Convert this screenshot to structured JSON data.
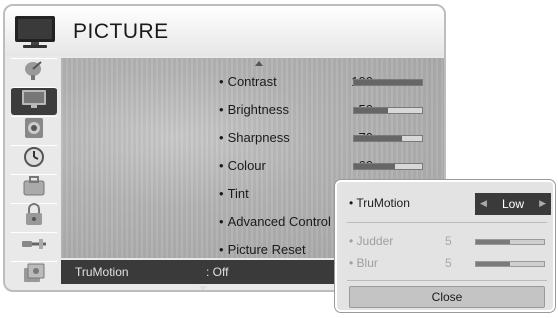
{
  "header": {
    "title": "PICTURE",
    "icon": "tv-icon"
  },
  "sidebar": {
    "items": [
      {
        "icon": "satellite-dish-icon"
      },
      {
        "icon": "tv-picture-icon",
        "active": true
      },
      {
        "icon": "speaker-audio-icon"
      },
      {
        "icon": "clock-icon"
      },
      {
        "icon": "briefcase-option-icon"
      },
      {
        "icon": "lock-icon"
      },
      {
        "icon": "input-cable-icon"
      },
      {
        "icon": "media-usb-icon"
      }
    ]
  },
  "menu": {
    "items": [
      {
        "label": "Contrast",
        "value": "100",
        "level": 1.0
      },
      {
        "label": "Brightness",
        "value": "50",
        "level": 0.5
      },
      {
        "label": "Sharpness",
        "value": "70",
        "level": 0.7
      },
      {
        "label": "Colour",
        "value": "60",
        "level": 0.6
      },
      {
        "label": "Tint"
      },
      {
        "label": "Advanced Control"
      },
      {
        "label": "Picture Reset"
      }
    ]
  },
  "status": {
    "label": "TruMotion",
    "value": ": Off"
  },
  "popup": {
    "trumotion_label": "TruMotion",
    "trumotion_value": "Low",
    "judder_label": "Judder",
    "judder_value": "5",
    "judder_level": 0.5,
    "blur_label": "Blur",
    "blur_value": "5",
    "blur_level": 0.5,
    "close_label": "Close"
  },
  "colors": {
    "accent_dark": "#3a3a3a",
    "panel": "#e9e9e9"
  }
}
